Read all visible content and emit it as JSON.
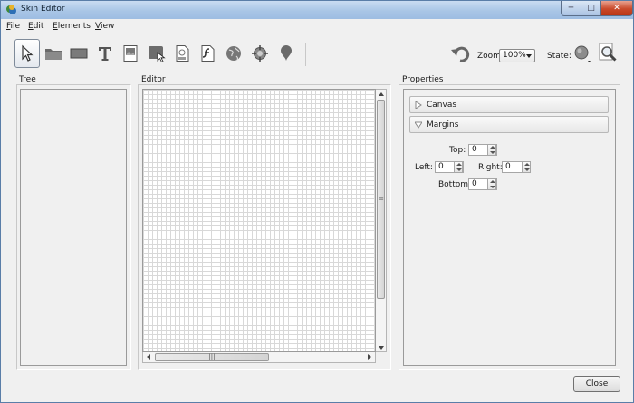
{
  "window": {
    "title": "Skin Editor",
    "min_label": "─",
    "max_label": "□",
    "close_label": "✕"
  },
  "menu": [
    {
      "mnemonic": "F",
      "rest": "ile"
    },
    {
      "mnemonic": "E",
      "rest": "dit"
    },
    {
      "mnemonic": "E",
      "rest": "lements"
    },
    {
      "mnemonic": "V",
      "rest": "iew"
    }
  ],
  "toolbar": {
    "tools": [
      "pointer-icon",
      "folder-icon",
      "rectangle-icon",
      "text-icon",
      "image-icon",
      "button-icon",
      "svg-icon",
      "flash-icon",
      "globe-icon",
      "target-icon",
      "map-pin-icon"
    ],
    "undo_icon": "undo-icon",
    "zoom_label": "Zoom:",
    "zoom_value": "100%",
    "state_label": "State:"
  },
  "panels": {
    "tree": "Tree",
    "editor": "Editor",
    "properties": "Properties"
  },
  "properties": {
    "sections": [
      {
        "label": "Canvas",
        "expanded": false
      },
      {
        "label": "Margins",
        "expanded": true
      }
    ],
    "margins": {
      "top_label": "Top:",
      "top": "0",
      "left_label": "Left:",
      "left": "0",
      "right_label": "Right:",
      "right": "0",
      "bottom_label": "Bottom:",
      "bottom": "0"
    }
  },
  "scroll_grip": "≡",
  "hscroll_grip": "|||",
  "buttons": {
    "close": "Close"
  }
}
